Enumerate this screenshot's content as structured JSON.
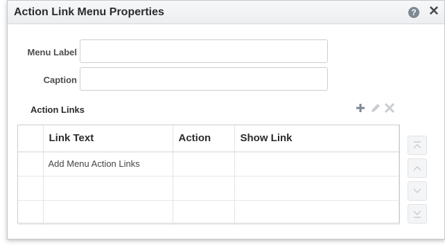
{
  "dialog": {
    "title": "Action Link Menu Properties",
    "help_icon": "help-icon",
    "help_glyph": "?",
    "close_icon": "close-icon",
    "close_glyph": "✕"
  },
  "form": {
    "menu_label": {
      "label": "Menu Label",
      "value": ""
    },
    "caption": {
      "label": "Caption",
      "value": ""
    }
  },
  "action_links": {
    "title": "Action Links",
    "toolbar": [
      {
        "name": "add-icon",
        "enabled": true
      },
      {
        "name": "edit-icon",
        "enabled": false
      },
      {
        "name": "delete-icon",
        "enabled": false
      }
    ],
    "columns": [
      "",
      "Link Text",
      "Action",
      "Show Link"
    ],
    "rows": [
      [
        "",
        "Add Menu Action Links",
        "",
        ""
      ],
      [
        "",
        "",
        "",
        ""
      ],
      [
        "",
        "",
        "",
        ""
      ]
    ],
    "move_buttons": [
      "move-top-icon",
      "move-up-icon",
      "move-down-icon",
      "move-bottom-icon"
    ]
  },
  "colors": {
    "accent_disabled": "#c8ccd0",
    "icon_dark": "#7d8891",
    "border": "#c9ced2"
  }
}
